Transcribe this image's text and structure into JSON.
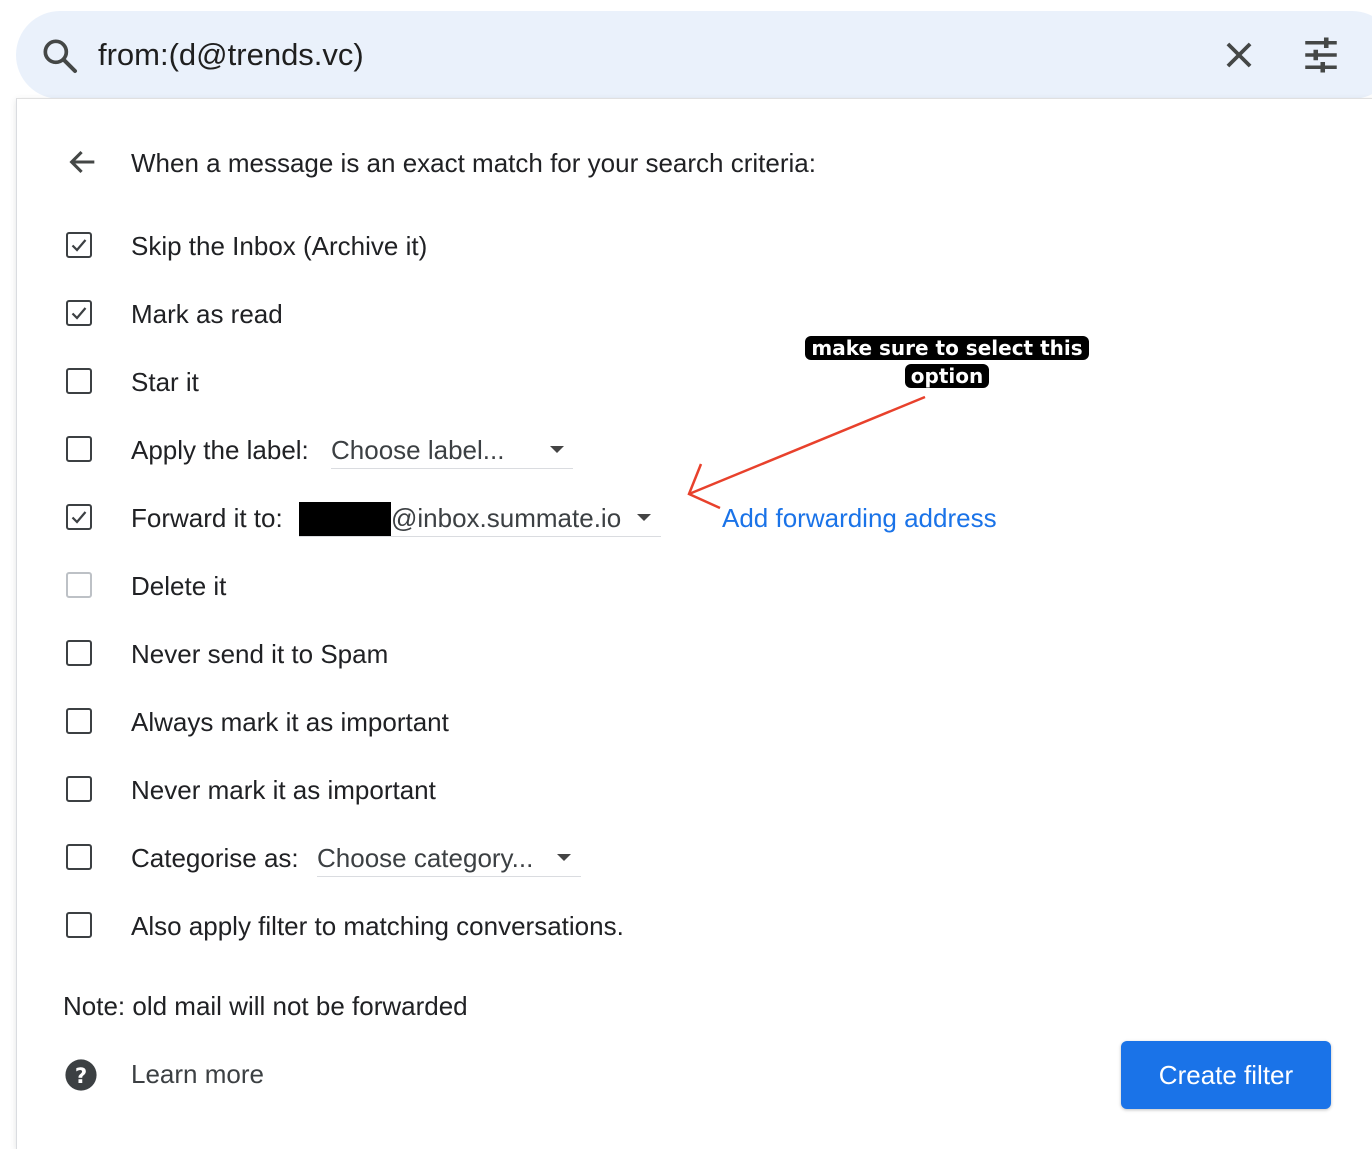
{
  "search": {
    "query": "from:(d@trends.vc)",
    "search_icon": "search-icon",
    "clear_icon": "close-icon",
    "options_icon": "tune-icon"
  },
  "filter": {
    "back_icon": "arrow-back-icon",
    "heading": "When a message is an exact match for your search criteria:",
    "options": [
      {
        "label": "Skip the Inbox (Archive it)",
        "checked": true
      },
      {
        "label": "Mark as read",
        "checked": true
      },
      {
        "label": "Star it",
        "checked": false
      },
      {
        "label": "Apply the label:",
        "checked": false,
        "select_value": "Choose label..."
      },
      {
        "label": "Forward it to:",
        "checked": true,
        "select_value": "@inbox.summate.io"
      },
      {
        "label": "Delete it",
        "checked": false,
        "disabled": true
      },
      {
        "label": "Never send it to Spam",
        "checked": false
      },
      {
        "label": "Always mark it as important",
        "checked": false
      },
      {
        "label": "Never mark it as important",
        "checked": false
      },
      {
        "label": "Categorise as:",
        "checked": false,
        "select_value": "Choose category..."
      },
      {
        "label": "Also apply filter to matching conversations.",
        "checked": false
      }
    ],
    "add_forwarding_link": "Add forwarding address",
    "note": "Note: old mail will not be forwarded",
    "help_icon": "help-icon",
    "learn_more": "Learn more",
    "create_button": "Create filter"
  },
  "annotation": {
    "callout_line1": "make sure to select this",
    "callout_line2": "option",
    "arrow_color": "#e8412c"
  },
  "colors": {
    "search_bg": "#eaf1fb",
    "link": "#1a73e8",
    "primary_button": "#1a73e8"
  }
}
